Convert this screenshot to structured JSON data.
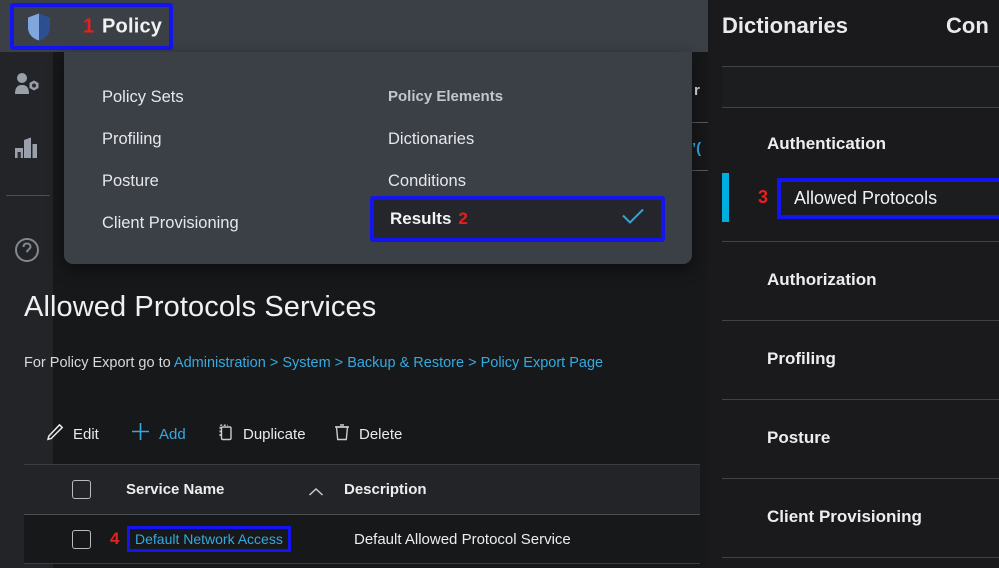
{
  "topbar": {
    "policy_number": "1",
    "policy_label": "Policy",
    "shield_icon": "shield-icon"
  },
  "rail": {
    "items": [
      {
        "icon": "user-admin-icon",
        "name": "administration"
      },
      {
        "icon": "bar-chart-icon",
        "name": "operations"
      },
      {
        "icon": "help-circle-icon",
        "name": "help"
      }
    ]
  },
  "dropdown": {
    "left_column": [
      {
        "label": "Policy Sets"
      },
      {
        "label": "Profiling"
      },
      {
        "label": "Posture"
      },
      {
        "label": "Client Provisioning"
      }
    ],
    "right_column_header": "Policy Elements",
    "right_column": [
      {
        "label": "Dictionaries"
      },
      {
        "label": "Conditions"
      }
    ],
    "highlighted_item": {
      "label": "Results",
      "number": "2",
      "check_icon": "check-icon"
    }
  },
  "peek": {
    "fragment_1": "r",
    "fragment_2": "’("
  },
  "content": {
    "page_title": "Allowed Protocols Services",
    "subline": {
      "prefix": "For Policy Export go to ",
      "links": [
        "Administration",
        "System",
        "Backup & Restore",
        "Policy Export Page"
      ],
      "separator": " > "
    },
    "toolbar": [
      {
        "icon": "pencil-icon",
        "label": "Edit"
      },
      {
        "icon": "plus-icon",
        "label": "Add"
      },
      {
        "icon": "duplicate-icon",
        "label": "Duplicate"
      },
      {
        "icon": "trash-icon",
        "label": "Delete"
      }
    ],
    "table": {
      "columns": [
        "Service Name",
        "Description"
      ],
      "sort_icon": "chevron-up-icon",
      "rows": [
        {
          "number": "4",
          "service_name": "Default Network Access",
          "description": "Default Allowed Protocol Service"
        }
      ]
    }
  },
  "right_pane": {
    "tabs": [
      {
        "label": "Dictionaries"
      },
      {
        "label": "Con"
      }
    ],
    "authentication_group": {
      "title": "Authentication",
      "selected_number": "3",
      "selected_label": "Allowed Protocols"
    },
    "groups": [
      {
        "label": "Authorization"
      },
      {
        "label": "Profiling"
      },
      {
        "label": "Posture"
      },
      {
        "label": "Client Provisioning"
      }
    ]
  },
  "colors": {
    "annotation_box": "#1414f0",
    "annotation_number": "#e8201c",
    "link": "#37a9e0",
    "accent_bar": "#00aee0",
    "topbar_bg": "#3b3f46",
    "page_bg": "#17181a"
  }
}
